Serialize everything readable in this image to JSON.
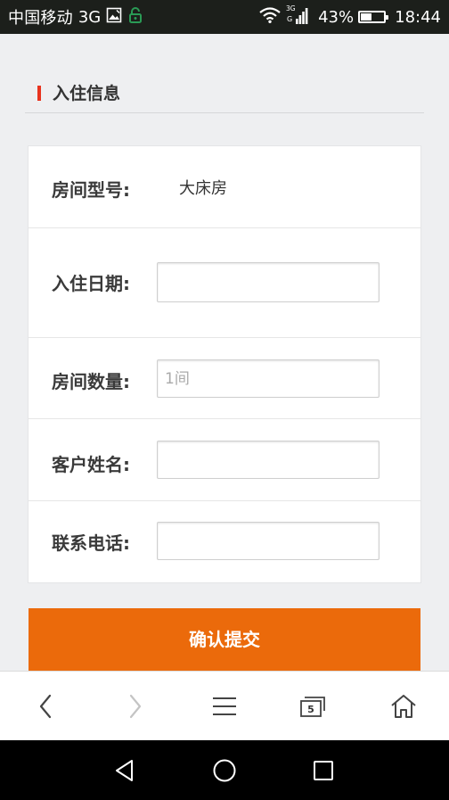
{
  "status_bar": {
    "carrier": "中国移动",
    "network": "3G",
    "signal_label": "3G",
    "battery_percent": "43%",
    "battery_level": 0.43,
    "time": "18:44"
  },
  "section": {
    "title": "入住信息",
    "accent_color": "#e8331e"
  },
  "form": {
    "rows": [
      {
        "label": "房间型号:",
        "value": "大床房"
      },
      {
        "label": "入住日期:",
        "value": "",
        "placeholder": ""
      },
      {
        "label": "房间数量:",
        "value": "",
        "placeholder": "1间"
      },
      {
        "label": "客户姓名:",
        "value": "",
        "placeholder": ""
      },
      {
        "label": "联系电话:",
        "value": "",
        "placeholder": ""
      }
    ]
  },
  "submit": {
    "label": "确认提交",
    "color": "#eb6a0b"
  },
  "browser_toolbar": {
    "tab_count": "5",
    "icons": [
      "back-icon",
      "forward-icon",
      "menu-icon",
      "tabs-icon",
      "home-icon"
    ]
  },
  "nav_bar": {
    "icons": [
      "nav-back-icon",
      "nav-home-icon",
      "nav-recents-icon"
    ]
  }
}
